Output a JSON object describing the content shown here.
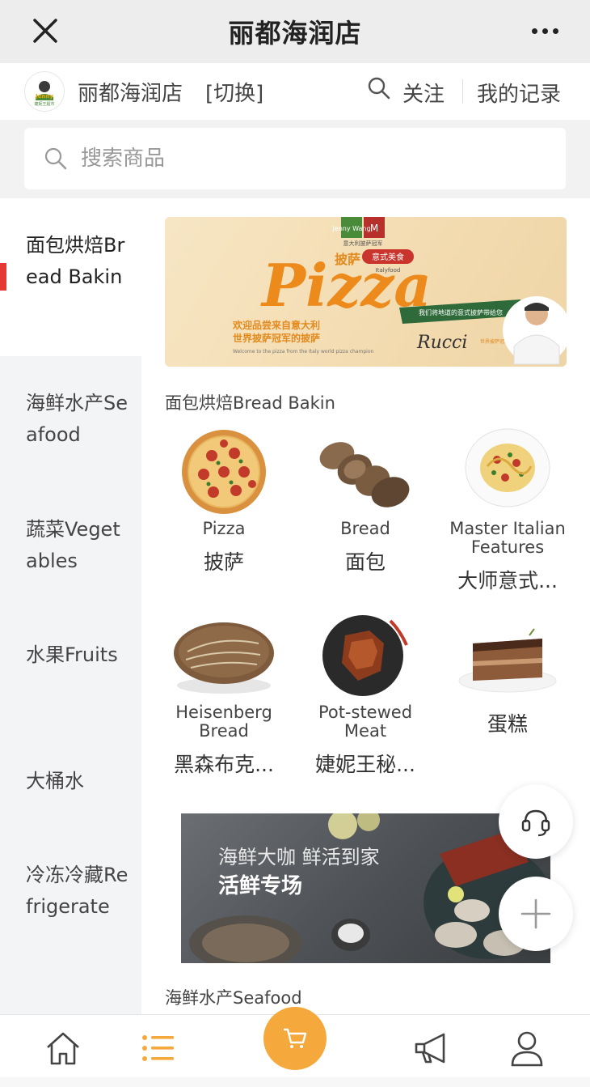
{
  "titlebar": {
    "title": "丽都海润店"
  },
  "storebar": {
    "store_name": "丽都海润店",
    "switch_label": "[切换]",
    "follow_label": "关注",
    "records_label": "我的记录"
  },
  "search": {
    "placeholder": "搜索商品"
  },
  "sidebar": {
    "items": [
      {
        "label": "面包烘焙Bread Bakin",
        "active": true
      },
      {
        "label": "海鲜水产Seafood"
      },
      {
        "label": "蔬菜Vegetables"
      },
      {
        "label": "水果Fruits"
      },
      {
        "label": "大桶水"
      },
      {
        "label": "冷冻冷藏Refrigerate"
      }
    ]
  },
  "banner1": {
    "badge_left": "披萨",
    "headline": "Pizza",
    "tag": "意式美食",
    "subtag": "Italyfood",
    "ribbon": "我们将地道的意式披萨带给您",
    "line1": "欢迎品尝来自意大利",
    "line2": "世界披萨冠军的披萨",
    "english": "Welcome to the pizza from the Italy world pizza champion",
    "signature": "Rucci",
    "champion_tag": "世界披萨冠军",
    "logo_caption": "意大利披萨冠军",
    "logo_text": "Jenny Wang",
    "logo_right": "M"
  },
  "section1": {
    "title": "面包烘焙Bread Bakin",
    "products": [
      {
        "en": "Pizza",
        "cn": "披萨",
        "icon": "pizza-icon"
      },
      {
        "en": "Bread",
        "cn": "面包",
        "icon": "bread-icon"
      },
      {
        "en": "Master Italian Features",
        "cn": "大师意式...",
        "icon": "pasta-icon"
      },
      {
        "en": "Heisenberg Bread",
        "cn": "黑森布克...",
        "icon": "loaf-icon"
      },
      {
        "en": "Pot-stewed Meat",
        "cn": "婕妮王秘...",
        "icon": "meat-icon"
      },
      {
        "en": "",
        "cn": "蛋糕",
        "icon": "cake-icon"
      }
    ]
  },
  "banner2": {
    "line1": "海鲜大咖 鲜活到家",
    "line2": "活鲜专场"
  },
  "section2": {
    "title": "海鲜水产Seafood"
  },
  "colors": {
    "accent_orange": "#f5a93c",
    "active_red": "#e53935",
    "sidebar_bg": "#f3f4f6"
  }
}
